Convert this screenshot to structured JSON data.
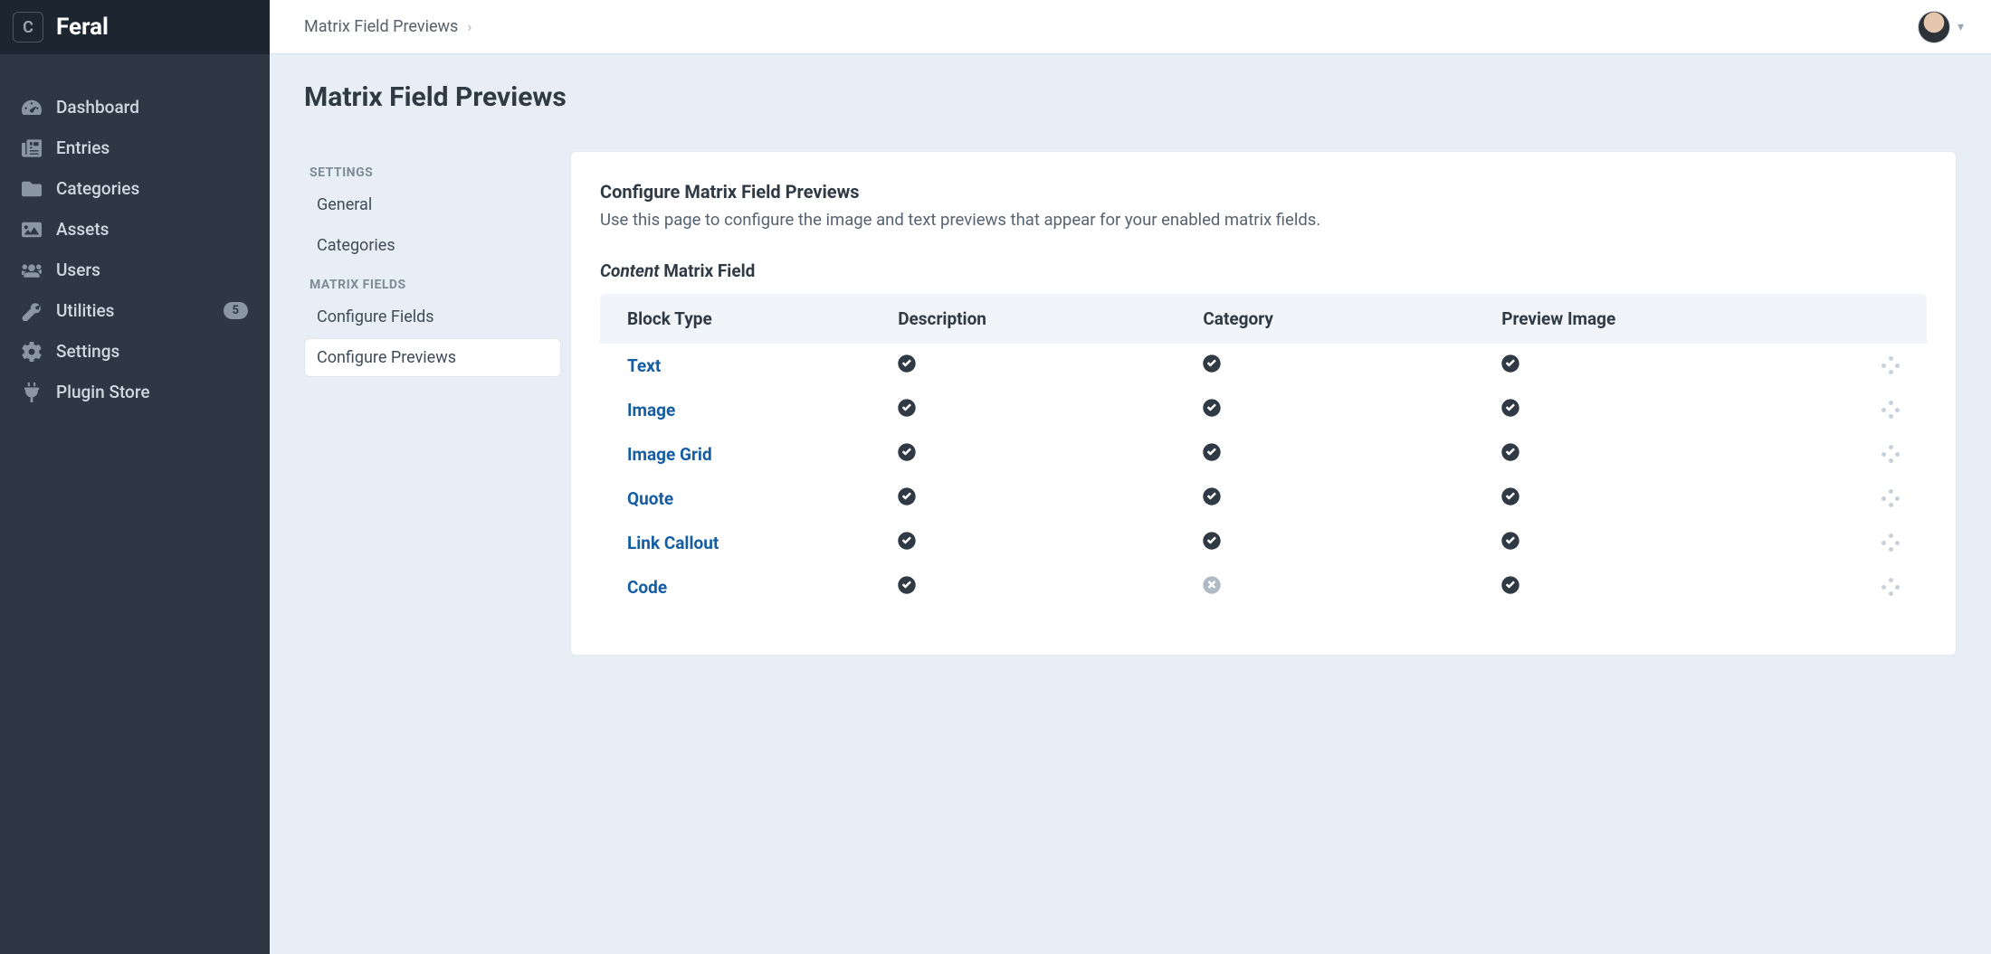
{
  "brand": {
    "initial": "C",
    "name": "Feral"
  },
  "nav": {
    "items": [
      {
        "label": "Dashboard",
        "icon": "gauge",
        "badge": null
      },
      {
        "label": "Entries",
        "icon": "newspaper",
        "badge": null
      },
      {
        "label": "Categories",
        "icon": "folder",
        "badge": null
      },
      {
        "label": "Assets",
        "icon": "image",
        "badge": null
      },
      {
        "label": "Users",
        "icon": "users",
        "badge": null
      },
      {
        "label": "Utilities",
        "icon": "wrench",
        "badge": "5"
      },
      {
        "label": "Settings",
        "icon": "gear",
        "badge": null
      },
      {
        "label": "Plugin Store",
        "icon": "plug",
        "badge": null
      }
    ]
  },
  "topbar": {
    "crumb": "Matrix Field Previews"
  },
  "page": {
    "title": "Matrix Field Previews"
  },
  "sidenav": {
    "groups": [
      {
        "heading": "SETTINGS",
        "items": [
          {
            "label": "General",
            "selected": false
          },
          {
            "label": "Categories",
            "selected": false
          }
        ]
      },
      {
        "heading": "MATRIX FIELDS",
        "items": [
          {
            "label": "Configure Fields",
            "selected": false
          },
          {
            "label": "Configure Previews",
            "selected": true
          }
        ]
      }
    ]
  },
  "panel": {
    "title": "Configure Matrix Field Previews",
    "subtitle": "Use this page to configure the image and text previews that appear for your enabled matrix fields.",
    "section_field_name": "Content",
    "section_field_suffix": "Matrix Field",
    "columns": [
      "Block Type",
      "Description",
      "Category",
      "Preview Image"
    ],
    "rows": [
      {
        "name": "Text",
        "description": true,
        "category": true,
        "preview_image": true
      },
      {
        "name": "Image",
        "description": true,
        "category": true,
        "preview_image": true
      },
      {
        "name": "Image Grid",
        "description": true,
        "category": true,
        "preview_image": true
      },
      {
        "name": "Quote",
        "description": true,
        "category": true,
        "preview_image": true
      },
      {
        "name": "Link Callout",
        "description": true,
        "category": true,
        "preview_image": true
      },
      {
        "name": "Code",
        "description": true,
        "category": false,
        "preview_image": true
      }
    ]
  }
}
